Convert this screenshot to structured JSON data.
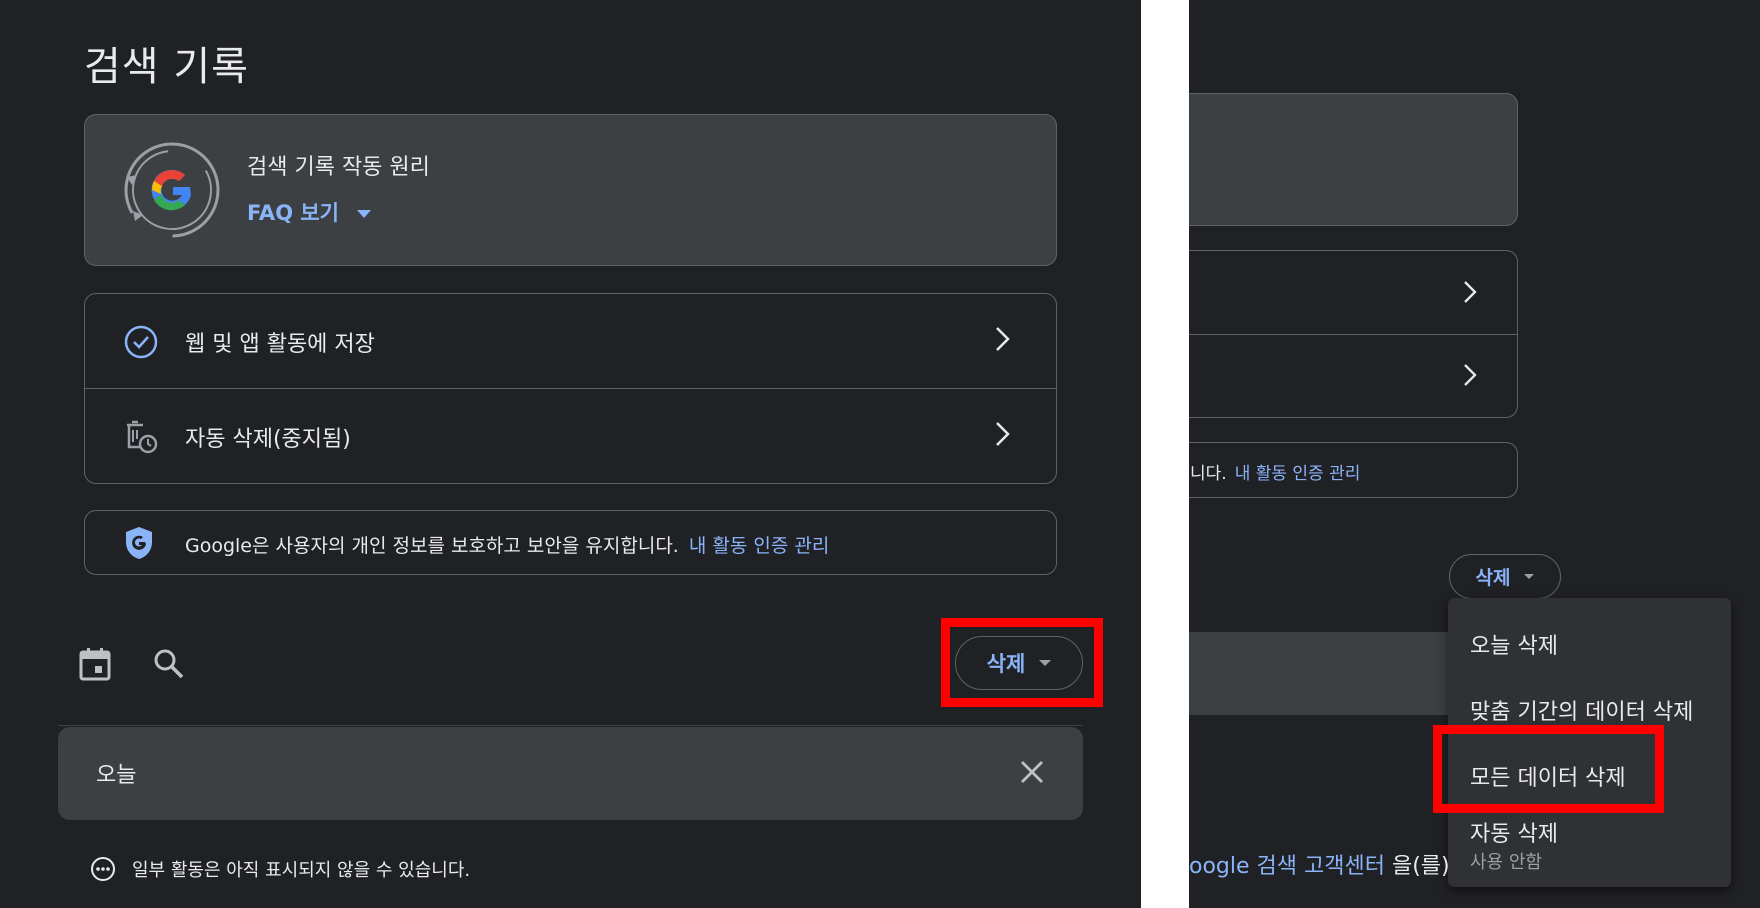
{
  "left": {
    "title": "검색 기록",
    "faq": {
      "heading": "검색 기록 작동 원리",
      "link": "FAQ 보기"
    },
    "settings": [
      {
        "label": "웹 및 앱 활동에 저장"
      },
      {
        "label": "자동 삭제(중지됨)"
      }
    ],
    "privacy": {
      "text": "Google은 사용자의 개인 정보를 보호하고 보안을 유지합니다.",
      "link": "내 활동 인증 관리"
    },
    "delete_button": "삭제",
    "today_label": "오늘",
    "notice": "일부 활동은 아직 표시되지 않을 수 있습니다."
  },
  "right": {
    "privacy_fragment": "니다.",
    "privacy_link": "내 활동 인증 관리",
    "delete_button": "삭제",
    "menu": {
      "today": "오늘 삭제",
      "custom_range": "맞춤 기간의 데이터 삭제",
      "all": "모든 데이터 삭제",
      "auto": "자동 삭제",
      "auto_status": "사용 안함"
    },
    "help": {
      "prefix": "oogle 검색 고객센터",
      "suffix": " 을(를)"
    }
  },
  "colors": {
    "background": "#202124",
    "card": "#3c4043",
    "accent": "#8ab4f8",
    "highlight": "#ff0000",
    "menu": "#303134"
  }
}
